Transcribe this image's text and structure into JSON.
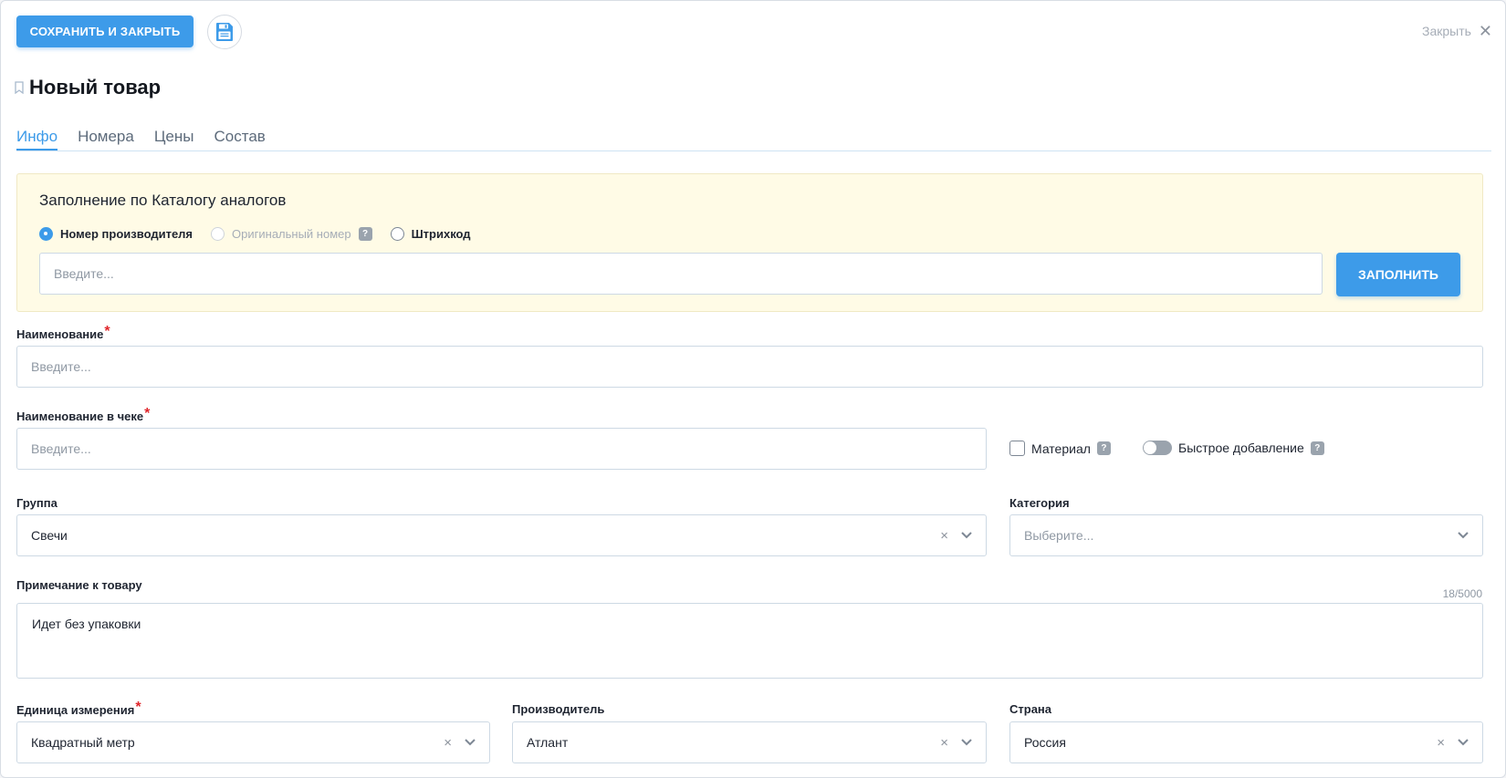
{
  "toolbar": {
    "save_close_label": "СОХРАНИТЬ И ЗАКРЫТЬ",
    "save_icon": "floppy-disk-icon",
    "close_label": "Закрыть",
    "close_icon": "✕"
  },
  "header": {
    "title": "Новый товар",
    "bookmark_icon": "bookmark-icon"
  },
  "tabs": [
    {
      "label": "Инфо",
      "active": true
    },
    {
      "label": "Номера",
      "active": false
    },
    {
      "label": "Цены",
      "active": false
    },
    {
      "label": "Состав",
      "active": false
    }
  ],
  "catalog": {
    "title": "Заполнение по Каталогу аналогов",
    "options": [
      {
        "label": "Номер производителя",
        "state": "checked"
      },
      {
        "label": "Оригинальный номер",
        "state": "disabled",
        "help": "?"
      },
      {
        "label": "Штрихкод",
        "state": "unchecked"
      }
    ],
    "input_placeholder": "Введите...",
    "fill_button": "ЗАПОЛНИТЬ"
  },
  "form": {
    "name": {
      "label": "Наименование",
      "required": "*",
      "placeholder": "Введите..."
    },
    "receipt_name": {
      "label": "Наименование в чеке",
      "required": "*",
      "placeholder": "Введите..."
    },
    "material": {
      "label": "Материал",
      "checked": false,
      "help": "?"
    },
    "quick_add": {
      "label": "Быстрое добавление",
      "on": false,
      "help": "?"
    },
    "group": {
      "label": "Группа",
      "value": "Свечи",
      "clear": "×"
    },
    "category": {
      "label": "Категория",
      "placeholder": "Выберите..."
    },
    "note": {
      "label": "Примечание к товару",
      "value": "Идет без упаковки",
      "counter": "18/5000"
    },
    "unit": {
      "label": "Единица измерения",
      "required": "*",
      "value": "Квадратный метр",
      "clear": "×"
    },
    "manufacturer": {
      "label": "Производитель",
      "value": "Атлант",
      "clear": "×"
    },
    "country": {
      "label": "Страна",
      "value": "Россия",
      "clear": "×"
    }
  },
  "colors": {
    "accent": "#3d9be9",
    "panel_bg": "#fffbe6",
    "required": "#e0262b"
  }
}
